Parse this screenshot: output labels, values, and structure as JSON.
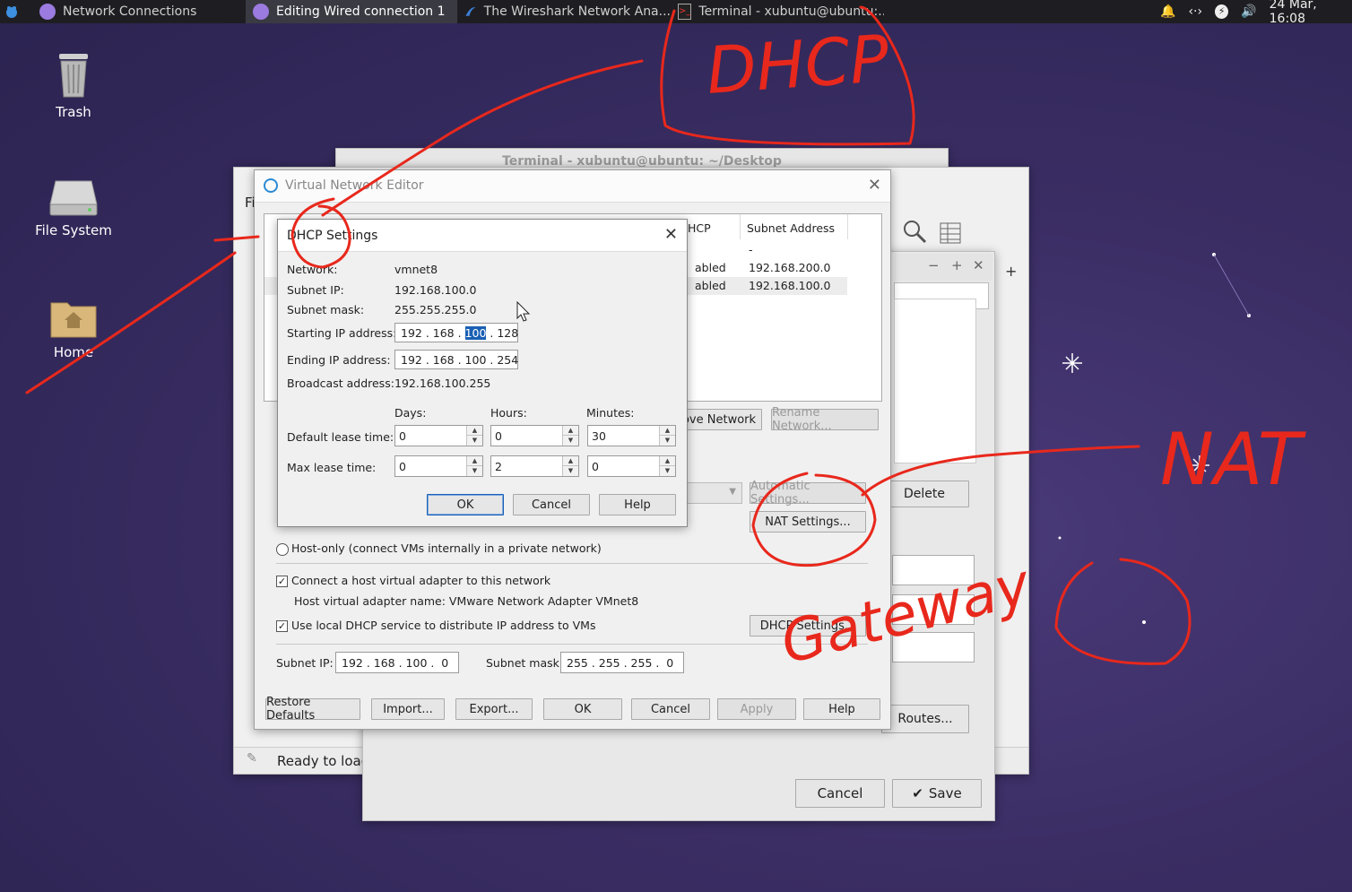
{
  "panel": {
    "tasks": [
      {
        "label": "Network Connections"
      },
      {
        "label": "Editing Wired connection 1"
      },
      {
        "label": "The Wireshark Network Ana..."
      },
      {
        "label": "Terminal - xubuntu@ubuntu:..."
      }
    ],
    "clock": "24 Mar, 16:08"
  },
  "desktop": {
    "icons": [
      {
        "label": "Trash"
      },
      {
        "label": "File System"
      },
      {
        "label": "Home"
      }
    ]
  },
  "terminal_bg": {
    "title": "Terminal - xubuntu@ubuntu: ~/Desktop"
  },
  "editing_window": {
    "buttons": {
      "delete": "Delete",
      "routes": "Routes...",
      "cancel": "Cancel",
      "save": "Save"
    }
  },
  "wireshark": {
    "menu_letter": "Fi",
    "status": "Ready to load"
  },
  "vne": {
    "title": "Virtual Network Editor",
    "table": {
      "headers": {
        "dhcp": "HCP",
        "subnet": "Subnet Address"
      },
      "rows": [
        {
          "dhcp": "",
          "subnet": "-"
        },
        {
          "dhcp": "abled",
          "subnet": "192.168.200.0"
        },
        {
          "dhcp": "abled",
          "subnet": "192.168.100.0"
        }
      ]
    },
    "buttons": {
      "remove_network": "ove Network",
      "rename_network": "Rename Network...",
      "automatic_settings": "Automatic Settings...",
      "nat_settings": "NAT Settings...",
      "dhcp_settings": "DHCP Settings...",
      "restore_defaults": "Restore Defaults",
      "import": "Import...",
      "export": "Export...",
      "ok": "OK",
      "cancel": "Cancel",
      "apply": "Apply",
      "help": "Help"
    },
    "host_only_label": "Host-only (connect VMs internally in a private network)",
    "connect_adapter_label": "Connect a host virtual adapter to this network",
    "adapter_name_label": "Host virtual adapter name: VMware Network Adapter VMnet8",
    "use_dhcp_label": "Use local DHCP service to distribute IP address to VMs",
    "subnet_ip_label": "Subnet IP:",
    "subnet_ip_value": "192 . 168 . 100 .  0",
    "subnet_mask_label": "Subnet mask:",
    "subnet_mask_value": "255 . 255 . 255 .  0"
  },
  "dhcp": {
    "title": "DHCP Settings",
    "network_label": "Network:",
    "network_value": "vmnet8",
    "subnet_ip_label": "Subnet IP:",
    "subnet_ip_value": "192.168.100.0",
    "subnet_mask_label": "Subnet mask:",
    "subnet_mask_value": "255.255.255.0",
    "start_label": "Starting IP address:",
    "start_oct": [
      "192",
      "168",
      "100",
      "128"
    ],
    "end_label": "Ending IP address:",
    "end_value": "192 . 168 . 100 . 254",
    "broadcast_label": "Broadcast address:",
    "broadcast_value": "192.168.100.255",
    "days_label": "Days:",
    "hours_label": "Hours:",
    "minutes_label": "Minutes:",
    "default_lease_label": "Default lease time:",
    "default_lease": {
      "days": "0",
      "hours": "0",
      "minutes": "30"
    },
    "max_lease_label": "Max lease time:",
    "max_lease": {
      "days": "0",
      "hours": "2",
      "minutes": "0"
    },
    "ok": "OK",
    "cancel": "Cancel",
    "help": "Help"
  },
  "annotations": {
    "dhcp": "DHCP",
    "nat": "NAT",
    "gateway": "Gateway"
  },
  "colors": {
    "annotation": "#e8281c",
    "panel": "#1e1e22",
    "desktop": "#3a2d63",
    "selection": "#1a5fb4"
  }
}
